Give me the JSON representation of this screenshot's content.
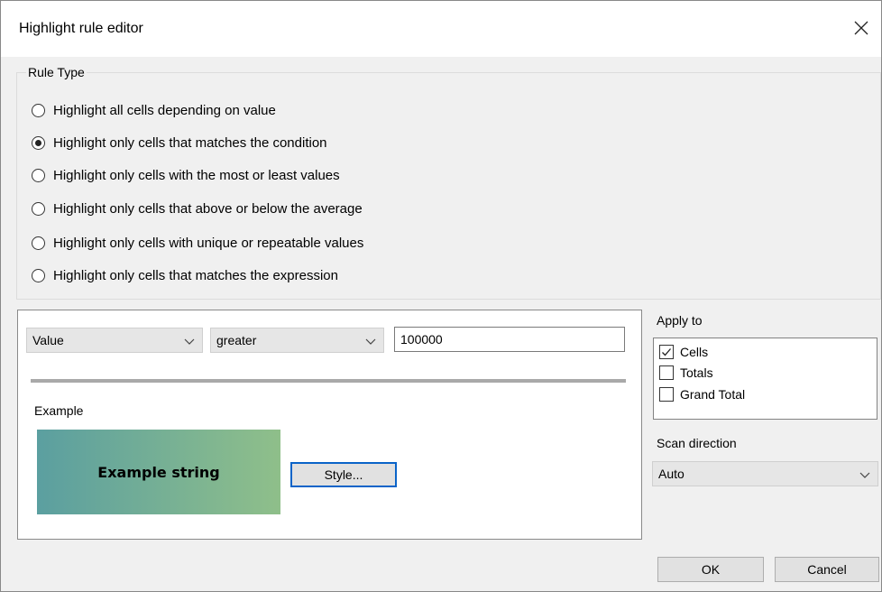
{
  "window": {
    "title": "Highlight rule editor"
  },
  "rule_type": {
    "legend": "Rule Type",
    "options": [
      {
        "label": "Highlight all cells depending on value",
        "selected": false
      },
      {
        "label": "Highlight only cells that matches the condition",
        "selected": true
      },
      {
        "label": "Highlight only cells with the most or least values",
        "selected": false
      },
      {
        "label": "Highlight only cells that above or below the average",
        "selected": false
      },
      {
        "label": "Highlight only cells with unique or repeatable values",
        "selected": false
      },
      {
        "label": "Highlight only cells that matches the expression",
        "selected": false
      }
    ]
  },
  "condition": {
    "field": "Value",
    "operator": "greater",
    "value": "100000"
  },
  "example": {
    "label": "Example",
    "text": "Example string",
    "style_button": "Style...",
    "gradient_start": "#5b9fa0",
    "gradient_end": "#8fbf8a"
  },
  "apply_to": {
    "label": "Apply to",
    "items": [
      {
        "label": "Cells",
        "checked": true
      },
      {
        "label": "Totals",
        "checked": false
      },
      {
        "label": "Grand Total",
        "checked": false
      }
    ]
  },
  "scan_direction": {
    "label": "Scan direction",
    "value": "Auto"
  },
  "buttons": {
    "ok": "OK",
    "cancel": "Cancel"
  },
  "colors": {
    "focus_border": "#0a64c8",
    "dialog_bg": "#f0f0f0"
  }
}
